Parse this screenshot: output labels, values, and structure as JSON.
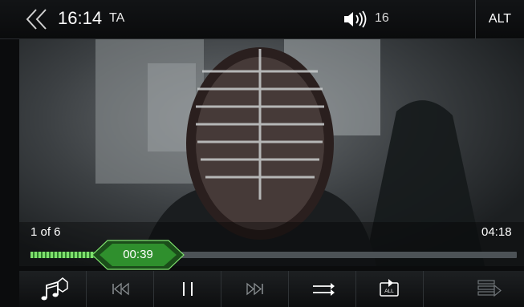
{
  "status_bar": {
    "time": "16:14",
    "ta_label": "TA",
    "volume_level": "16",
    "alt_label": "ALT"
  },
  "player": {
    "track_position": "1 of 6",
    "elapsed": "00:39",
    "duration": "04:18",
    "progress_fraction": 0.151
  },
  "controls": [
    {
      "name": "music-source-button",
      "icon": "music-notes-icon",
      "enabled": true
    },
    {
      "name": "previous-track-button",
      "icon": "skip-previous-icon",
      "enabled": false
    },
    {
      "name": "pause-button",
      "icon": "pause-icon",
      "enabled": true
    },
    {
      "name": "next-track-button",
      "icon": "skip-next-icon",
      "enabled": false
    },
    {
      "name": "shuffle-button",
      "icon": "shuffle-arrows-icon",
      "enabled": true
    },
    {
      "name": "repeat-all-button",
      "icon": "repeat-all-icon",
      "enabled": true
    },
    {
      "name": "playlist-button",
      "icon": "playlist-icon",
      "enabled": false
    }
  ],
  "colors": {
    "accent_green": "#2f8f2d",
    "accent_green_light": "#7ee06d",
    "background": "#0b0c0d"
  }
}
